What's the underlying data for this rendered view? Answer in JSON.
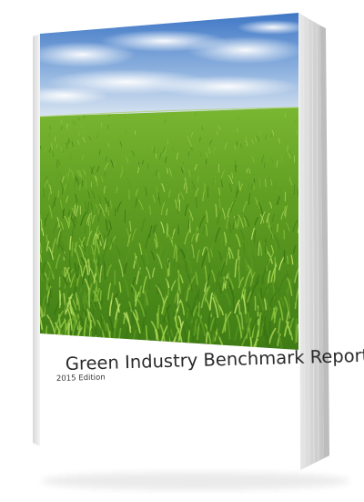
{
  "book": {
    "title": "Green Industry Benchmark Report",
    "edition": "2015 Edition"
  },
  "colors": {
    "sky_top": "#3f78c8",
    "sky_bottom": "#d9e6f3",
    "grass_light": "#8cc83a",
    "grass_dark": "#2f6a12",
    "page_white": "#ffffff",
    "spine_gray": "#cfcfcf"
  }
}
